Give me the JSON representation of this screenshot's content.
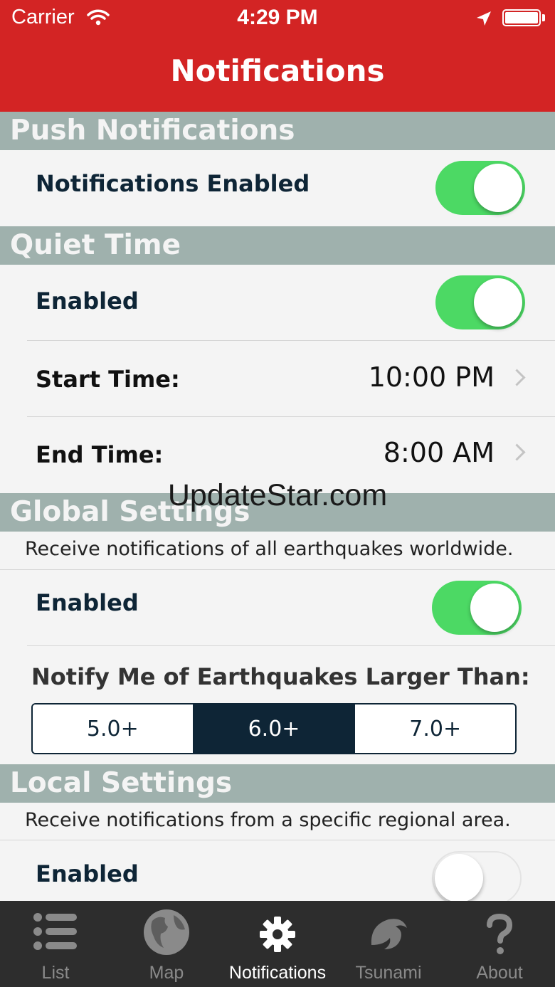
{
  "status_bar": {
    "carrier": "Carrier",
    "time": "4:29 PM"
  },
  "nav": {
    "title": "Notifications"
  },
  "push": {
    "header": "Push Notifications",
    "enabled_label": "Notifications Enabled",
    "enabled": true
  },
  "quiet": {
    "header": "Quiet Time",
    "enabled_label": "Enabled",
    "enabled": true,
    "start_label": "Start Time:",
    "start_value": "10:00 PM",
    "end_label": "End Time:",
    "end_value": "8:00 AM"
  },
  "global": {
    "header": "Global Settings",
    "description": "Receive notifications of all earthquakes worldwide.",
    "enabled_label": "Enabled",
    "enabled": true,
    "magnitude_label": "Notify Me of Earthquakes Larger Than:",
    "magnitude_options": [
      "5.0+",
      "6.0+",
      "7.0+"
    ],
    "magnitude_selected": "6.0+"
  },
  "local": {
    "header": "Local Settings",
    "description": "Receive notifications from a specific regional area.",
    "enabled_label": "Enabled",
    "enabled": false
  },
  "watermark": "UpdateStar.com",
  "tabbar": {
    "tabs": [
      {
        "label": "List",
        "icon": "list-icon"
      },
      {
        "label": "Map",
        "icon": "globe-icon"
      },
      {
        "label": "Notifications",
        "icon": "gear-icon"
      },
      {
        "label": "Tsunami",
        "icon": "wave-icon"
      },
      {
        "label": "About",
        "icon": "question-icon"
      }
    ],
    "active": "Notifications"
  },
  "colors": {
    "header_red": "#d32424",
    "section_gray": "#9fb1ad",
    "toggle_green": "#4cd964",
    "navy": "#0e2536",
    "tabbar_bg": "#2d2d2d"
  }
}
